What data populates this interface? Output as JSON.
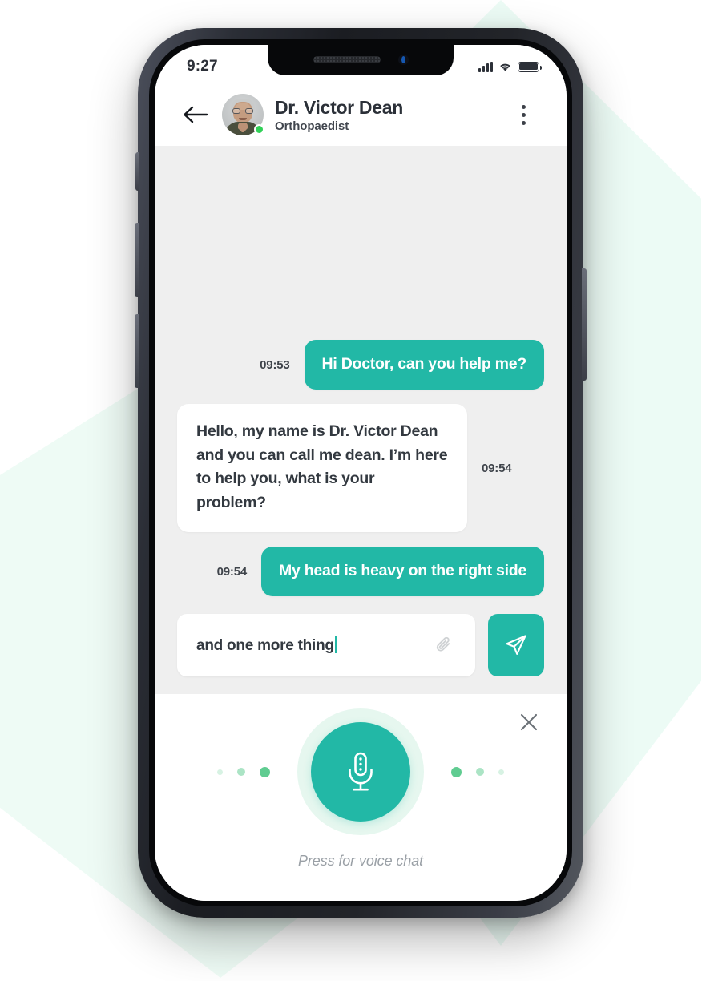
{
  "status_bar": {
    "clock": "9:27",
    "signal_icon": "cellular-signal-icon",
    "wifi_icon": "wifi-icon",
    "battery_icon": "battery-full-icon"
  },
  "header": {
    "back_icon": "arrow-left-icon",
    "avatar_alt": "doctor-avatar",
    "online_status": "online",
    "doctor_name": "Dr. Victor Dean",
    "doctor_role": "Orthopaedist",
    "menu_icon": "more-vertical-icon"
  },
  "chat": {
    "messages": [
      {
        "text": "Hi Doctor, can you help me?",
        "time": "09:53",
        "side": "out"
      },
      {
        "text": "Hello, my name is Dr. Victor Dean and you can call me dean. I’m here to help you, what is your problem?",
        "time": "09:54",
        "side": "in"
      },
      {
        "text": "My head is heavy on the right side",
        "time": "09:54",
        "side": "out"
      }
    ]
  },
  "composer": {
    "input_value": "and one more thing",
    "input_placeholder": "Type a message",
    "attach_icon": "paperclip-icon",
    "send_icon": "send-plane-icon"
  },
  "voice_panel": {
    "close_icon": "close-x-icon",
    "mic_icon": "microphone-icon",
    "hint": "Press for voice chat",
    "left_dots": 3,
    "right_dots": 3
  },
  "colors": {
    "accent": "#22B8A6",
    "chat_background": "#EFEFEF",
    "bubble_in": "#FFFFFF",
    "text_dark": "#333940",
    "online_green": "#31D158",
    "dot_green": "#57C98B",
    "halo_mint": "#E6F7EF",
    "hex_mint_right": "#E9FAF3",
    "hex_mint_left": "#ECFBF4"
  }
}
